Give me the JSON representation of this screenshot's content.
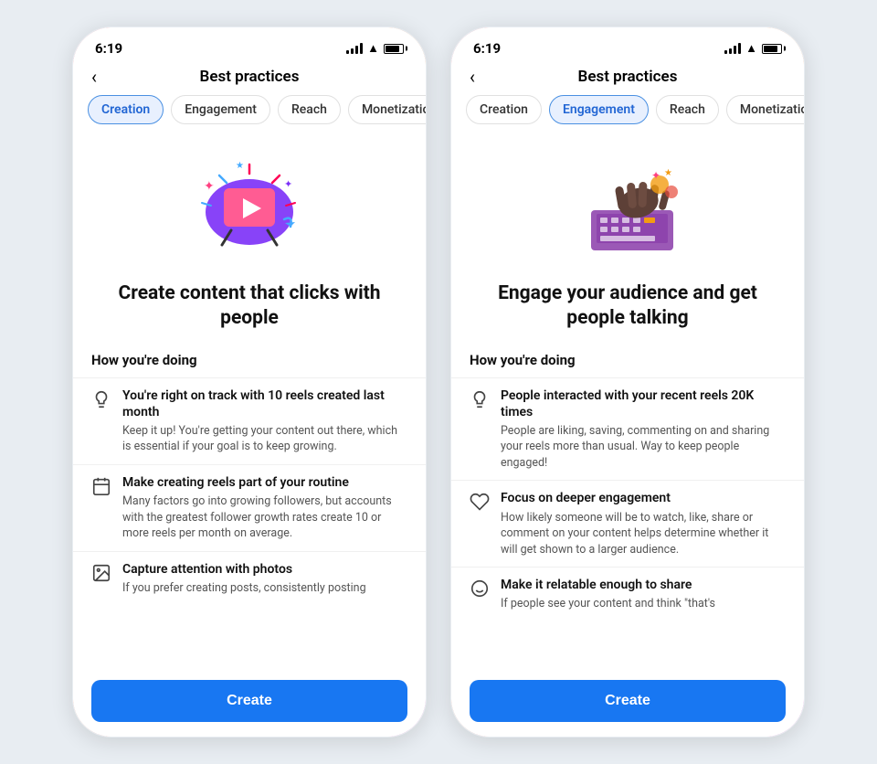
{
  "phone1": {
    "status": {
      "time": "6:19",
      "signal_label": "signal",
      "wifi_label": "wifi",
      "battery_label": "battery"
    },
    "header": {
      "back_label": "‹",
      "title": "Best practices"
    },
    "tabs": [
      {
        "label": "Creation",
        "active": true
      },
      {
        "label": "Engagement",
        "active": false
      },
      {
        "label": "Reach",
        "active": false
      },
      {
        "label": "Monetization",
        "active": false
      }
    ],
    "headline": "Create content that clicks with people",
    "section_label": "How you're doing",
    "tips": [
      {
        "icon": "lightbulb",
        "title": "You're right on track with 10 reels created last month",
        "desc": "Keep it up! You're getting your content out there, which is essential if your goal is to keep growing."
      },
      {
        "icon": "calendar",
        "title": "Make creating reels part of your routine",
        "desc": "Many factors go into growing followers, but accounts with the greatest follower growth rates create 10 or more reels per month on average."
      },
      {
        "icon": "image",
        "title": "Capture attention with photos",
        "desc": "If you prefer creating posts, consistently posting"
      }
    ],
    "cta_label": "Create"
  },
  "phone2": {
    "status": {
      "time": "6:19"
    },
    "header": {
      "back_label": "‹",
      "title": "Best practices"
    },
    "tabs": [
      {
        "label": "Creation",
        "active": false
      },
      {
        "label": "Engagement",
        "active": true
      },
      {
        "label": "Reach",
        "active": false
      },
      {
        "label": "Monetization",
        "active": false
      }
    ],
    "headline": "Engage your audience and get people talking",
    "section_label": "How you're doing",
    "tips": [
      {
        "icon": "lightbulb",
        "title": "People interacted with your recent reels 20K times",
        "desc": "People are liking, saving, commenting on and sharing your reels more than usual. Way to keep people engaged!"
      },
      {
        "icon": "heart",
        "title": "Focus on deeper engagement",
        "desc": "How likely someone will be to watch, like, share or comment on your content helps determine whether it will get shown to a larger audience."
      },
      {
        "icon": "smiley",
        "title": "Make it relatable enough to share",
        "desc": "If people see your content and think \"that's"
      }
    ],
    "cta_label": "Create"
  }
}
